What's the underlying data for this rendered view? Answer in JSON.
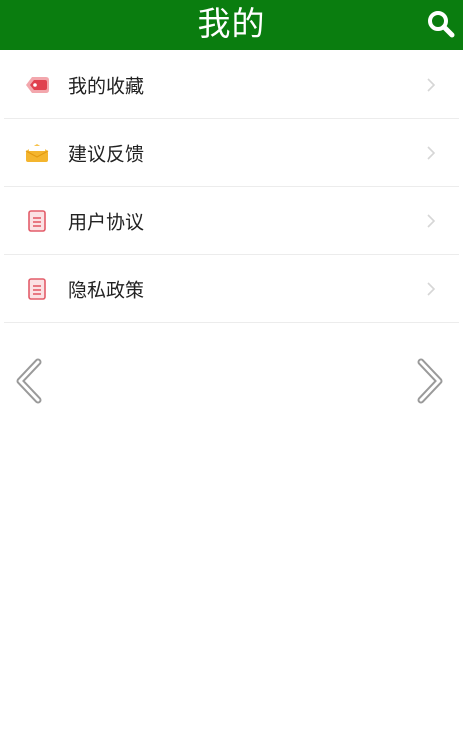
{
  "header": {
    "title": "我的",
    "background": "#0a7d0f",
    "search_icon": "search-icon"
  },
  "menu": {
    "items": [
      {
        "label": "我的收藏",
        "icon": "tag-icon"
      },
      {
        "label": "建议反馈",
        "icon": "envelope-icon"
      },
      {
        "label": "用户协议",
        "icon": "document-icon"
      },
      {
        "label": "隐私政策",
        "icon": "document-icon"
      }
    ]
  },
  "nav": {
    "prev_icon": "chevron-left-icon",
    "next_icon": "chevron-right-icon"
  }
}
